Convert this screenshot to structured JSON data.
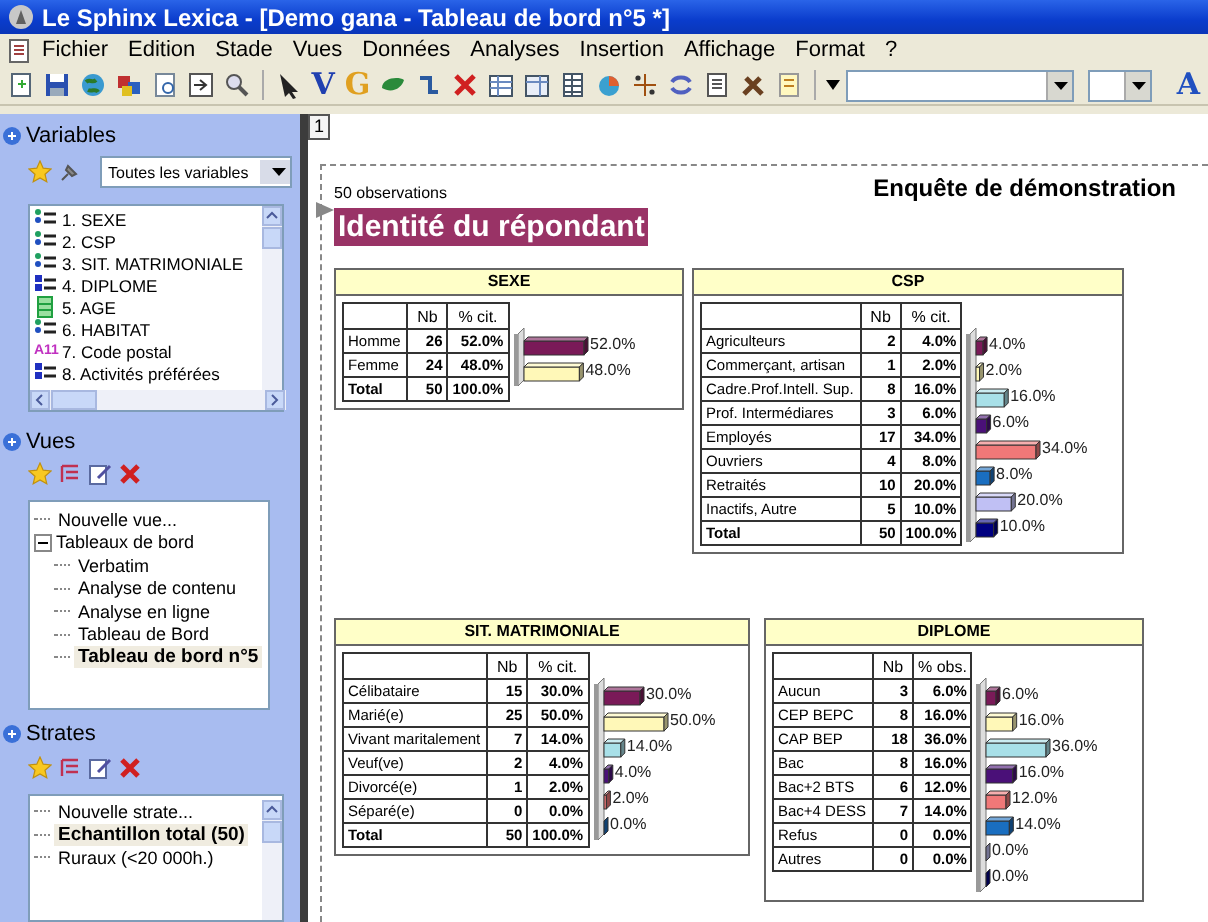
{
  "window": {
    "title": "Le Sphinx Lexica - [Demo gana - Tableau de bord n°5 *]"
  },
  "menu": [
    "Fichier",
    "Edition",
    "Stade",
    "Vues",
    "Données",
    "Analyses",
    "Insertion",
    "Affichage",
    "Format",
    "?"
  ],
  "toolbar": {
    "letter_buttons": [
      {
        "label": "V"
      },
      {
        "label": "G"
      }
    ],
    "font_button": "A"
  },
  "sidebar": {
    "variables": {
      "title": "Variables",
      "filter": "Toutes les variables",
      "items": [
        {
          "label": "1. SEXE",
          "kind": "closed"
        },
        {
          "label": "2. CSP",
          "kind": "closed"
        },
        {
          "label": "3. SIT. MATRIMONIALE",
          "kind": "closed"
        },
        {
          "label": "4. DIPLOME",
          "kind": "multiple"
        },
        {
          "label": "5. AGE",
          "kind": "numeric"
        },
        {
          "label": "6. HABITAT",
          "kind": "closed"
        },
        {
          "label": "7. Code postal",
          "kind": "text",
          "badge": "A11"
        },
        {
          "label": "8. Activités préférées",
          "kind": "multiple"
        }
      ]
    },
    "views": {
      "title": "Vues",
      "tree": [
        {
          "label": "Nouvelle vue...",
          "selected": false
        },
        {
          "label": "Tableaux de bord",
          "selected": false,
          "expanded": true,
          "children": [
            {
              "label": "Verbatim",
              "selected": false
            },
            {
              "label": "Analyse de contenu",
              "selected": false
            },
            {
              "label": "Analyse en ligne",
              "selected": false
            },
            {
              "label": "Tableau de Bord",
              "selected": false
            },
            {
              "label": "Tableau de bord n°5",
              "selected": true
            }
          ]
        }
      ]
    },
    "strata": {
      "title": "Strates",
      "tree": [
        {
          "label": "Nouvelle strate...",
          "selected": false
        },
        {
          "label": "Echantillon total (50)",
          "selected": true
        },
        {
          "label": "Ruraux (<20 000h.)",
          "selected": false
        }
      ]
    }
  },
  "document": {
    "page_marker": "1",
    "title": "Enquête de démonstration",
    "observations": "50 observations",
    "section": "Identité du répondant",
    "tables": [
      {
        "title": "SEXE",
        "columns": [
          "",
          "Nb",
          "% cit."
        ],
        "rows": [
          {
            "nb": "26",
            "pct": "52.0%"
          },
          {
            "nb": "24",
            "pct": "48.0%"
          }
        ],
        "total": {
          "label": "Total",
          "nb": "50",
          "pct": "100.0%"
        },
        "chart_data": {
          "type": "bar",
          "orientation": "horizontal",
          "categories": [
            "Homme",
            "Femme"
          ],
          "values": [
            52.0,
            48.0
          ],
          "value_labels": [
            "52.0%",
            "48.0%"
          ]
        }
      },
      {
        "title": "CSP",
        "columns": [
          "",
          "Nb",
          "% cit."
        ],
        "rows": [
          {
            "nb": "2",
            "pct": "4.0%"
          },
          {
            "nb": "1",
            "pct": "2.0%"
          },
          {
            "nb": "8",
            "pct": "16.0%"
          },
          {
            "nb": "3",
            "pct": "6.0%"
          },
          {
            "nb": "17",
            "pct": "34.0%"
          },
          {
            "nb": "4",
            "pct": "8.0%"
          },
          {
            "nb": "10",
            "pct": "20.0%"
          },
          {
            "nb": "5",
            "pct": "10.0%"
          }
        ],
        "total": {
          "label": "Total",
          "nb": "50",
          "pct": "100.0%"
        },
        "chart_data": {
          "type": "bar",
          "orientation": "horizontal",
          "categories": [
            "Agriculteurs",
            "Commerçant, artisan",
            "Cadre.Prof.Intell. Sup.",
            "Prof. Intermédiares",
            "Employés",
            "Ouvriers",
            "Retraités",
            "Inactifs, Autre"
          ],
          "values": [
            4.0,
            2.0,
            16.0,
            6.0,
            34.0,
            8.0,
            20.0,
            10.0
          ],
          "value_labels": [
            "4.0%",
            "2.0%",
            "16.0%",
            "6.0%",
            "34.0%",
            "8.0%",
            "20.0%",
            "10.0%"
          ]
        }
      },
      {
        "title": "SIT. MATRIMONIALE",
        "columns": [
          "",
          "Nb",
          "% cit."
        ],
        "rows": [
          {
            "nb": "15",
            "pct": "30.0%"
          },
          {
            "nb": "25",
            "pct": "50.0%"
          },
          {
            "nb": "7",
            "pct": "14.0%"
          },
          {
            "nb": "2",
            "pct": "4.0%"
          },
          {
            "nb": "1",
            "pct": "2.0%"
          },
          {
            "nb": "0",
            "pct": "0.0%"
          }
        ],
        "total": {
          "label": "Total",
          "nb": "50",
          "pct": "100.0%"
        },
        "chart_data": {
          "type": "bar",
          "orientation": "horizontal",
          "categories": [
            "Célibataire",
            "Marié(e)",
            "Vivant maritalement",
            "Veuf(ve)",
            "Divorcé(e)",
            "Séparé(e)"
          ],
          "values": [
            30.0,
            50.0,
            14.0,
            4.0,
            2.0,
            0.0
          ],
          "value_labels": [
            "30.0%",
            "50.0%",
            "14.0%",
            "4.0%",
            "2.0%",
            "0.0%"
          ]
        }
      },
      {
        "title": "DIPLOME",
        "columns": [
          "",
          "Nb",
          "% obs."
        ],
        "rows": [
          {
            "nb": "3",
            "pct": "6.0%"
          },
          {
            "nb": "8",
            "pct": "16.0%"
          },
          {
            "nb": "18",
            "pct": "36.0%"
          },
          {
            "nb": "8",
            "pct": "16.0%"
          },
          {
            "nb": "6",
            "pct": "12.0%"
          },
          {
            "nb": "7",
            "pct": "14.0%"
          },
          {
            "nb": "0",
            "pct": "0.0%"
          },
          {
            "nb": "0",
            "pct": "0.0%"
          }
        ],
        "chart_data": {
          "type": "bar",
          "orientation": "horizontal",
          "categories": [
            "Aucun",
            "CEP BEPC",
            "CAP BEP",
            "Bac",
            "Bac+2 BTS",
            "Bac+4 DESS",
            "Refus",
            "Autres"
          ],
          "values": [
            6.0,
            16.0,
            36.0,
            16.0,
            12.0,
            14.0,
            0.0,
            0.0
          ],
          "value_labels": [
            "6.0%",
            "16.0%",
            "36.0%",
            "16.0%",
            "12.0%",
            "14.0%",
            "0.0%",
            "0.0%"
          ]
        }
      }
    ]
  }
}
